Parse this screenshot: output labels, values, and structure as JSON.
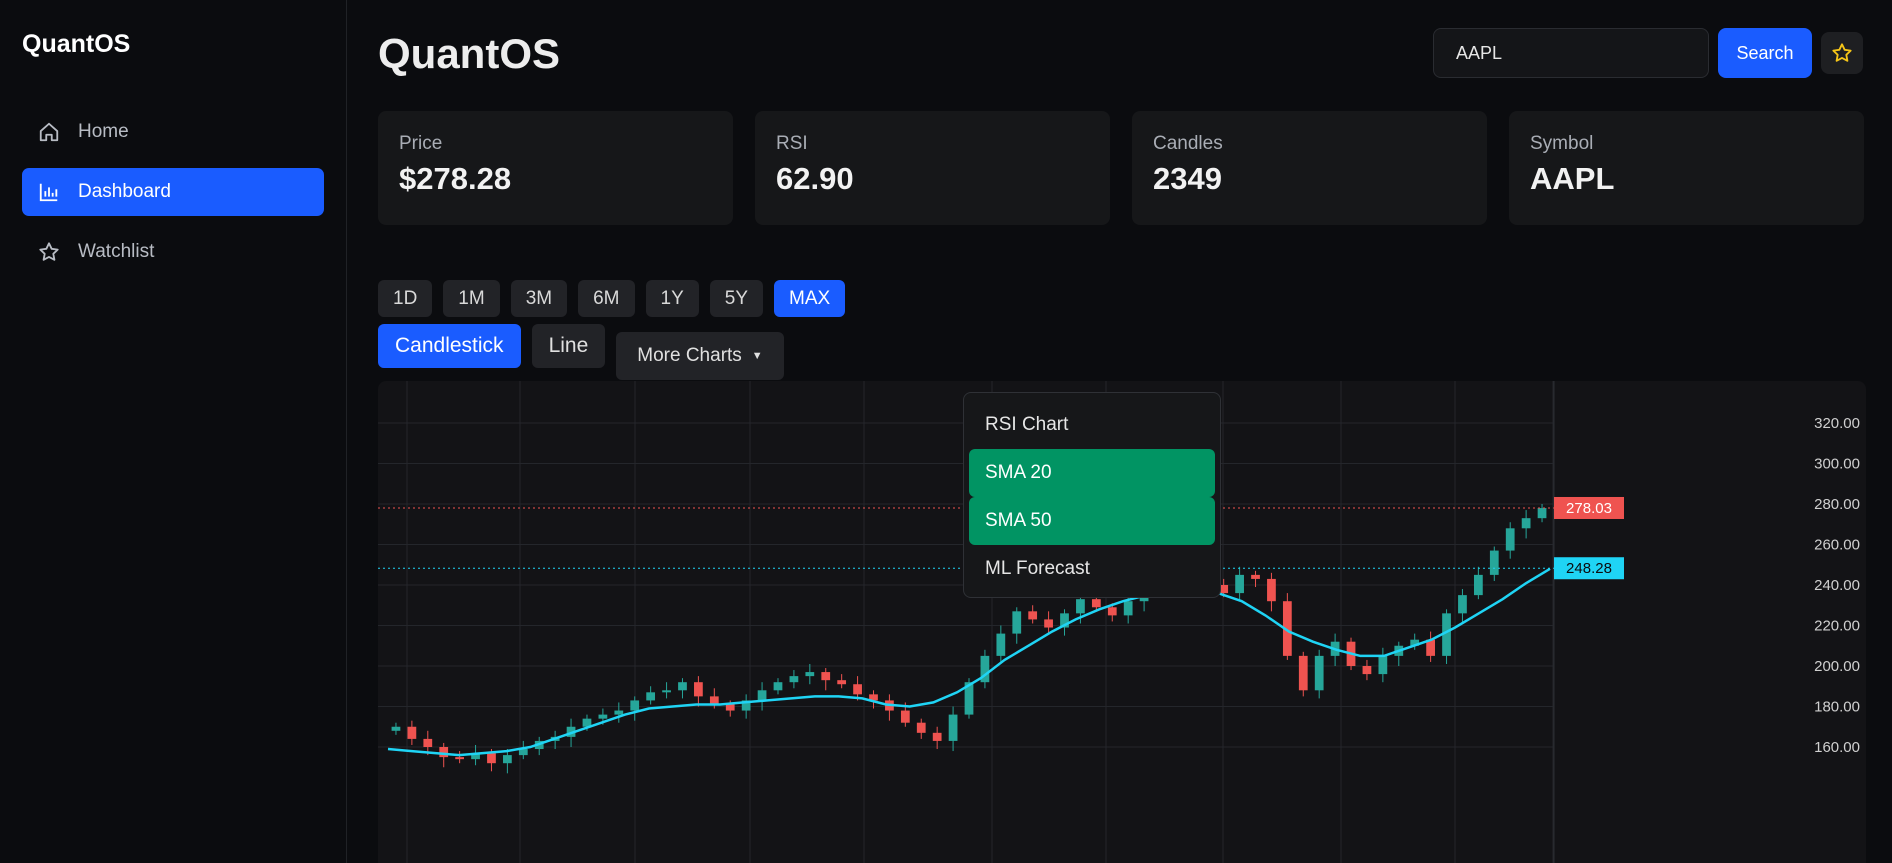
{
  "sidebar": {
    "brand": "QuantOS",
    "items": [
      {
        "label": "Home",
        "icon": "home-icon",
        "active": false
      },
      {
        "label": "Dashboard",
        "icon": "bar-chart-icon",
        "active": true
      },
      {
        "label": "Watchlist",
        "icon": "star-icon",
        "active": false
      }
    ]
  },
  "header": {
    "title": "QuantOS",
    "search_value": "AAPL",
    "search_button": "Search",
    "favorite_icon": "star-icon",
    "favorite_color": "#f5c518"
  },
  "stats": [
    {
      "label": "Price",
      "value": "$278.28"
    },
    {
      "label": "RSI",
      "value": "62.90"
    },
    {
      "label": "Candles",
      "value": "2349"
    },
    {
      "label": "Symbol",
      "value": "AAPL"
    }
  ],
  "ranges": [
    "1D",
    "1M",
    "3M",
    "6M",
    "1Y",
    "5Y",
    "MAX"
  ],
  "active_range": "MAX",
  "chart_types": [
    "Candlestick",
    "Line"
  ],
  "active_chart_type": "Candlestick",
  "more_charts": {
    "label": "More Charts",
    "options": [
      {
        "label": "RSI Chart",
        "selected": false
      },
      {
        "label": "SMA 20",
        "selected": true
      },
      {
        "label": "SMA 50",
        "selected": true
      },
      {
        "label": "ML Forecast",
        "selected": false
      }
    ]
  },
  "colors": {
    "accent": "#1a5cff",
    "up": "#26a69a",
    "down": "#ef5350",
    "sma": "#1fd4f5",
    "selected_option": "#019463"
  },
  "chart_data": {
    "type": "candlestick",
    "y_ticks": [
      "160.00",
      "180.00",
      "200.00",
      "220.00",
      "240.00",
      "260.00",
      "280.00",
      "300.00",
      "320.00"
    ],
    "ylim": [
      150,
      330
    ],
    "last_price_label": "278.03",
    "last_price": 278.03,
    "sma_label": "248.28",
    "sma_value": 248.28,
    "closes": [
      170,
      164,
      160,
      155,
      154,
      157,
      152,
      156,
      159,
      163,
      165,
      170,
      174,
      176,
      178,
      183,
      187,
      188,
      192,
      185,
      181,
      178,
      183,
      188,
      192,
      195,
      197,
      193,
      191,
      186,
      183,
      178,
      172,
      167,
      163,
      176,
      192,
      205,
      216,
      227,
      223,
      219,
      226,
      233,
      229,
      225,
      232,
      238,
      244,
      252,
      247,
      240,
      236,
      245,
      243,
      232,
      205,
      188,
      205,
      212,
      200,
      196,
      205,
      210,
      213,
      205,
      226,
      235,
      245,
      257,
      268,
      273,
      278
    ],
    "sma": [
      159,
      158,
      157,
      156,
      157,
      158,
      160,
      164,
      168,
      172,
      176,
      179,
      180,
      181,
      181,
      182,
      183,
      184,
      185,
      185,
      184,
      181,
      180,
      182,
      187,
      194,
      203,
      210,
      217,
      223,
      228,
      232,
      235,
      236,
      237,
      236,
      232,
      225,
      217,
      212,
      208,
      205,
      205,
      209,
      213,
      219,
      226,
      233,
      241,
      248
    ]
  }
}
